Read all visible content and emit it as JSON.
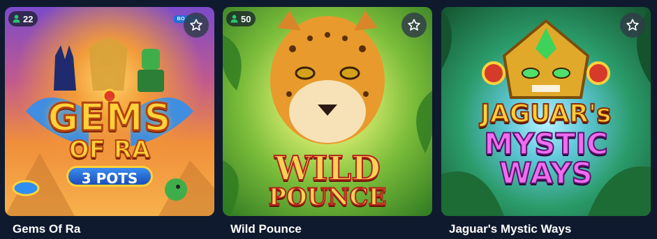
{
  "games": [
    {
      "title": "Gems Of Ra",
      "players": "22",
      "badge": "BO",
      "logo_line1": "GEMS",
      "logo_line2": "OF RA",
      "logo_line3": "3 POTS"
    },
    {
      "title": "Wild Pounce",
      "players": "50",
      "logo_line1": "WILD",
      "logo_line2": "POUNCE"
    },
    {
      "title": "Jaguar's Mystic Ways",
      "logo_line1": "JAGUAR's",
      "logo_line2": "MYSTIC",
      "logo_line3": "WAYS"
    }
  ],
  "icons": {
    "players": "person-icon",
    "favorite": "star-outline-icon"
  },
  "colors": {
    "page_background": "#0f1a2e",
    "players_icon": "#28c76f",
    "favorite_button": "#303c48"
  }
}
